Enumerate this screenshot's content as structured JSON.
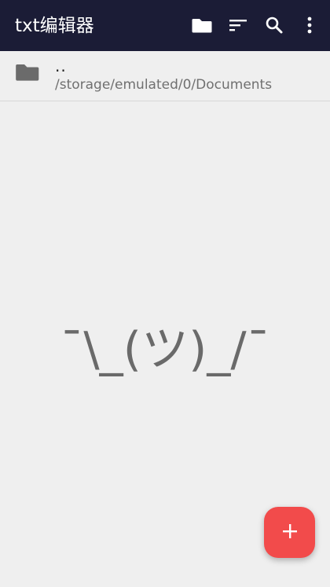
{
  "toolbar": {
    "title": "txt编辑器",
    "actions": {
      "folder": "folder-icon",
      "sort": "sort-icon",
      "search": "search-icon",
      "more": "more-vert-icon"
    }
  },
  "file_list": {
    "parent_label": "..",
    "current_path": "/storage/emulated/0/Documents"
  },
  "empty_state": {
    "text": "¯\\_(ツ)_/¯"
  },
  "fab": {
    "icon": "plus-icon"
  },
  "colors": {
    "toolbar_bg": "#1b1c36",
    "background": "#efefef",
    "fab": "#f24b4b",
    "empty_text": "#6a6a6a"
  }
}
